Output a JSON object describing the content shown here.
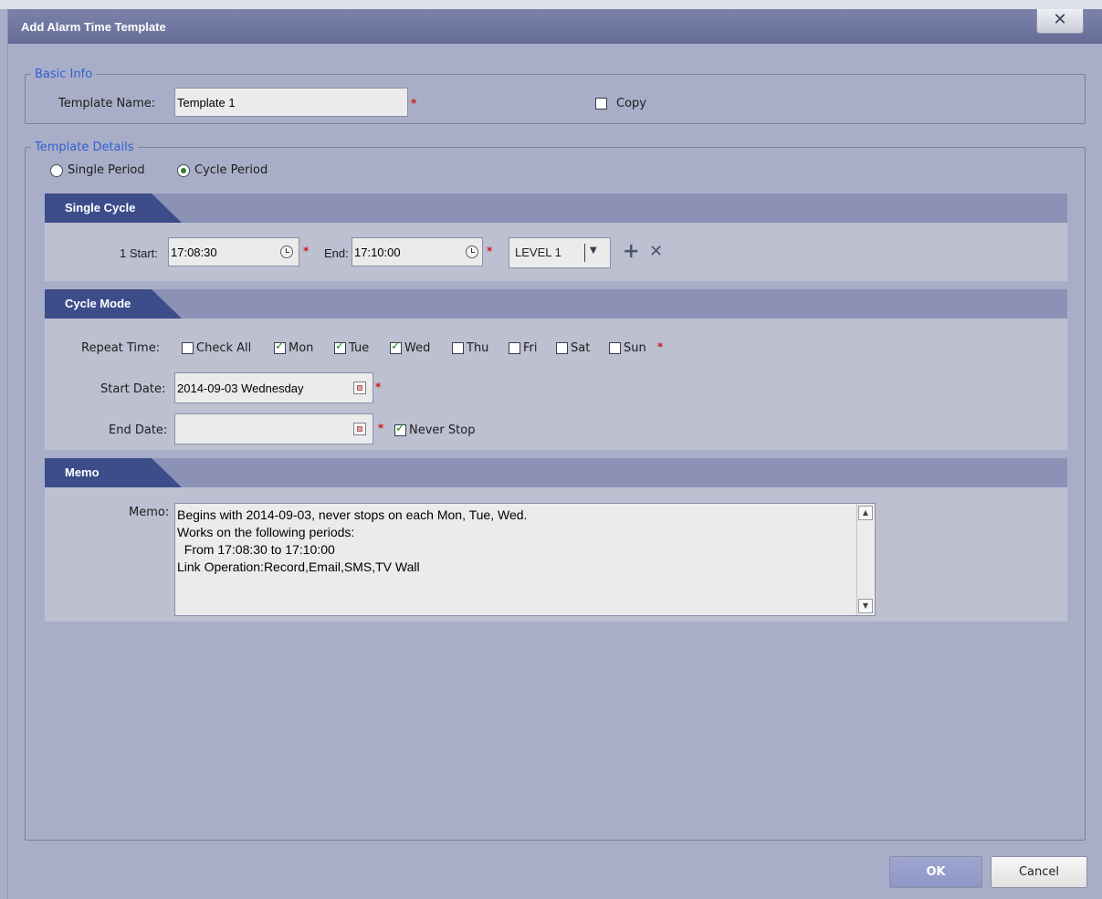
{
  "dialog": {
    "title": "Add Alarm Time Template",
    "close_glyph": "✕"
  },
  "basic_info": {
    "legend": "Basic Info",
    "template_name_label": "Template Name:",
    "template_name_value": "Template 1",
    "required_mark": "*",
    "copy_label": "Copy"
  },
  "template_details": {
    "legend": "Template Details",
    "single_period_label": "Single Period",
    "cycle_period_label": "Cycle Period",
    "selected_mode": "Cycle Period"
  },
  "single_cycle": {
    "header": "Single Cycle",
    "start_label": "1 Start:",
    "start_value": "17:08:30",
    "end_label": "End:",
    "end_value": "17:10:00",
    "level_value": "LEVEL 1",
    "add_glyph": "+",
    "delete_glyph": "✕"
  },
  "cycle_mode": {
    "header": "Cycle Mode",
    "repeat_label": "Repeat Time:",
    "check_all_label": "Check All",
    "days": [
      {
        "label": "Mon",
        "checked": true
      },
      {
        "label": "Tue",
        "checked": true
      },
      {
        "label": "Wed",
        "checked": true
      },
      {
        "label": "Thu",
        "checked": false
      },
      {
        "label": "Fri",
        "checked": false
      },
      {
        "label": "Sat",
        "checked": false
      },
      {
        "label": "Sun",
        "checked": false
      }
    ],
    "start_date_label": "Start Date:",
    "start_date_value": "2014-09-03 Wednesday",
    "end_date_label": "End Date:",
    "end_date_value": "",
    "never_stop_label": "Never Stop",
    "never_stop_checked": true
  },
  "memo": {
    "header": "Memo",
    "label": "Memo:",
    "text": "Begins with 2014-09-03, never stops on each Mon, Tue, Wed.\nWorks on the following periods:\n  From 17:08:30 to 17:10:00\nLink Operation:Record,Email,SMS,TV Wall"
  },
  "buttons": {
    "ok": "OK",
    "cancel": "Cancel"
  },
  "colors": {
    "title_bar": "#666e98",
    "section_tab": "#3c4d8a",
    "legend_text": "#2f5fd0",
    "required": "#d21a1a",
    "ok_button": "#9fa6d0"
  }
}
